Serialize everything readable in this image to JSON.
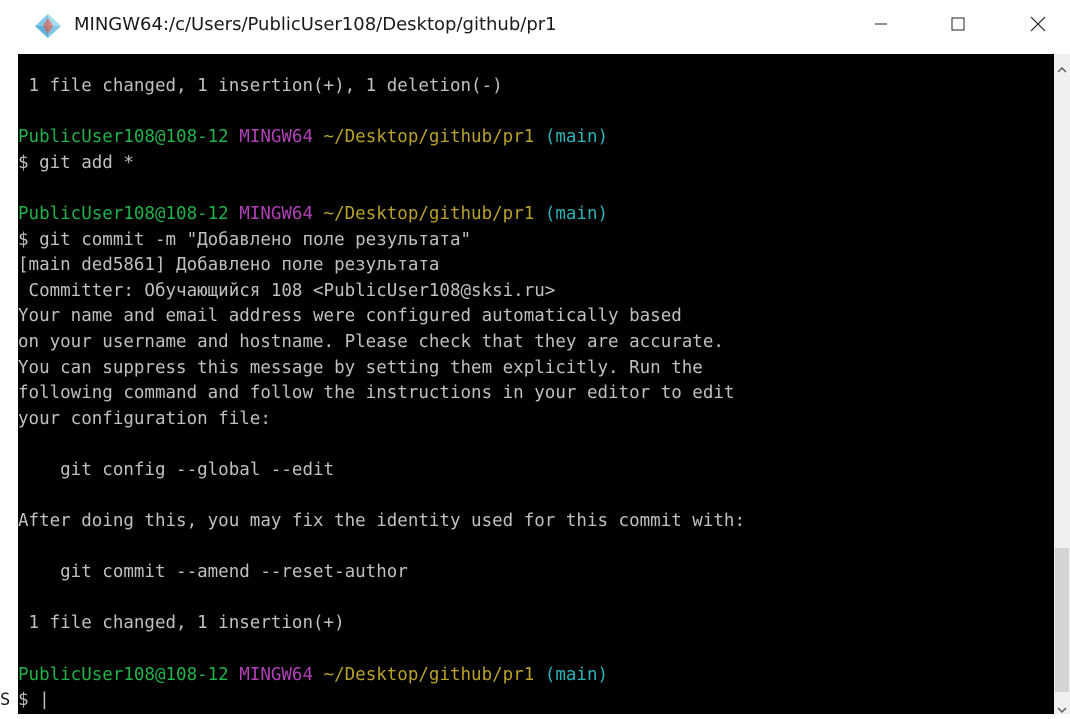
{
  "window": {
    "title": "MINGW64:/c/Users/PublicUser108/Desktop/github/pr1"
  },
  "terminal": {
    "lines": [
      {
        "segments": [
          {
            "text": " 1 file changed, 1 insertion(+), 1 deletion(-)",
            "color": "default"
          }
        ]
      },
      {
        "segments": []
      },
      {
        "segments": [
          {
            "text": "PublicUser108@108-12",
            "color": "user"
          },
          {
            "text": " MINGW64",
            "color": "sys"
          },
          {
            "text": " ~/Desktop/github/pr1",
            "color": "path"
          },
          {
            "text": " (main)",
            "color": "branch"
          }
        ]
      },
      {
        "segments": [
          {
            "text": "$ git add *",
            "color": "default"
          }
        ]
      },
      {
        "segments": []
      },
      {
        "segments": [
          {
            "text": "PublicUser108@108-12",
            "color": "user"
          },
          {
            "text": " MINGW64",
            "color": "sys"
          },
          {
            "text": " ~/Desktop/github/pr1",
            "color": "path"
          },
          {
            "text": " (main)",
            "color": "branch"
          }
        ]
      },
      {
        "segments": [
          {
            "text": "$ git commit -m \"Добавлено поле результата\"",
            "color": "default"
          }
        ]
      },
      {
        "segments": [
          {
            "text": "[main ded5861] Добавлено поле результата",
            "color": "default"
          }
        ]
      },
      {
        "segments": [
          {
            "text": " Committer: Обучающийся 108 <PublicUser108@sksi.ru>",
            "color": "default"
          }
        ]
      },
      {
        "segments": [
          {
            "text": "Your name and email address were configured automatically based",
            "color": "default"
          }
        ]
      },
      {
        "segments": [
          {
            "text": "on your username and hostname. Please check that they are accurate.",
            "color": "default"
          }
        ]
      },
      {
        "segments": [
          {
            "text": "You can suppress this message by setting them explicitly. Run the",
            "color": "default"
          }
        ]
      },
      {
        "segments": [
          {
            "text": "following command and follow the instructions in your editor to edit",
            "color": "default"
          }
        ]
      },
      {
        "segments": [
          {
            "text": "your configuration file:",
            "color": "default"
          }
        ]
      },
      {
        "segments": []
      },
      {
        "segments": [
          {
            "text": "    git config --global --edit",
            "color": "default"
          }
        ]
      },
      {
        "segments": []
      },
      {
        "segments": [
          {
            "text": "After doing this, you may fix the identity used for this commit with:",
            "color": "default"
          }
        ]
      },
      {
        "segments": []
      },
      {
        "segments": [
          {
            "text": "    git commit --amend --reset-author",
            "color": "default"
          }
        ]
      },
      {
        "segments": []
      },
      {
        "segments": [
          {
            "text": " 1 file changed, 1 insertion(+)",
            "color": "default"
          }
        ]
      },
      {
        "segments": []
      },
      {
        "segments": [
          {
            "text": "PublicUser108@108-12",
            "color": "user"
          },
          {
            "text": " MINGW64",
            "color": "sys"
          },
          {
            "text": " ~/Desktop/github/pr1",
            "color": "path"
          },
          {
            "text": " (main)",
            "color": "branch"
          }
        ]
      },
      {
        "segments": [
          {
            "text": "$ |",
            "color": "default"
          }
        ]
      }
    ]
  },
  "stray_text": "S",
  "colors": {
    "background": "#000000",
    "default": "#c0c0c0",
    "user": "#1fb34a",
    "sys": "#b23fb8",
    "path": "#b9a12a",
    "branch": "#2ab3b8"
  },
  "icons": {
    "app": "git-bash-icon",
    "minimize": "minimize-icon",
    "maximize": "maximize-icon",
    "close": "close-icon",
    "scroll_up": "scroll-up-arrow-icon",
    "scroll_down": "scroll-down-arrow-icon"
  }
}
